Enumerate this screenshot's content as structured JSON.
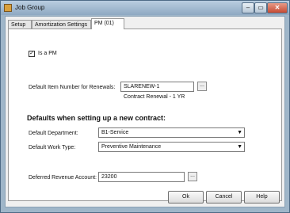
{
  "window": {
    "title": "Job Group"
  },
  "tabs": [
    {
      "label": "Setup"
    },
    {
      "label": "Amortization Settings"
    },
    {
      "label": "PM (01)"
    }
  ],
  "pm": {
    "is_pm_label": "Is a PM",
    "is_pm_checked": true,
    "default_item_label": "Default Item Number for Renewals:",
    "default_item_value": "SLARENEW-1",
    "default_item_description": "Contract Renewal - 1 YR",
    "defaults_heading": "Defaults when setting up a new contract:",
    "department_label": "Default Department:",
    "department_value": "B1-Service",
    "work_type_label": "Default Work Type:",
    "work_type_value": "Preventive Maintenance",
    "deferred_label": "Deferred Revenue Account:",
    "deferred_value": "23200"
  },
  "buttons": {
    "ok": "Ok",
    "cancel": "Cancel",
    "help": "Help"
  },
  "icons": {
    "ellipsis": "...",
    "dropdown": "▼",
    "check": "✓"
  }
}
